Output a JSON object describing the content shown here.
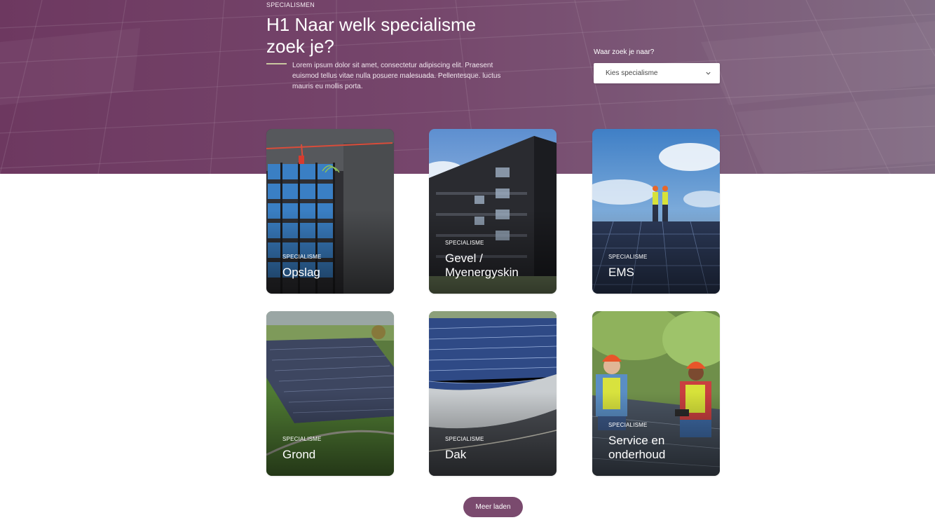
{
  "hero": {
    "eyebrow": "SPECIALISMEN",
    "title": "H1 Naar welk specialisme zoek je?",
    "description": "Lorem ipsum dolor sit amet, consectetur adipiscing elit. Praesent euismod tellus vitae nulla posuere malesuada. Pellentesque. luctus mauris eu mollis porta."
  },
  "filter": {
    "label": "Waar zoek je naar?",
    "select_value": "Kies specialisme",
    "icon": "chevron-down-icon"
  },
  "cards": [
    {
      "eyebrow": "SPECIALISME",
      "title": "Opslag"
    },
    {
      "eyebrow": "SPECIALISME",
      "title": "Gevel / Myenergyskin"
    },
    {
      "eyebrow": "SPECIALISME",
      "title": "EMS"
    },
    {
      "eyebrow": "SPECIALISME",
      "title": "Grond"
    },
    {
      "eyebrow": "SPECIALISME",
      "title": "Dak"
    },
    {
      "eyebrow": "SPECIALISME",
      "title": "Service en onderhoud"
    }
  ],
  "load_more": {
    "label": "Meer laden"
  },
  "colors": {
    "brand": "#7a4a6e",
    "hero_overlay": "#703a60",
    "accent_rule": "#c9c7a0"
  }
}
